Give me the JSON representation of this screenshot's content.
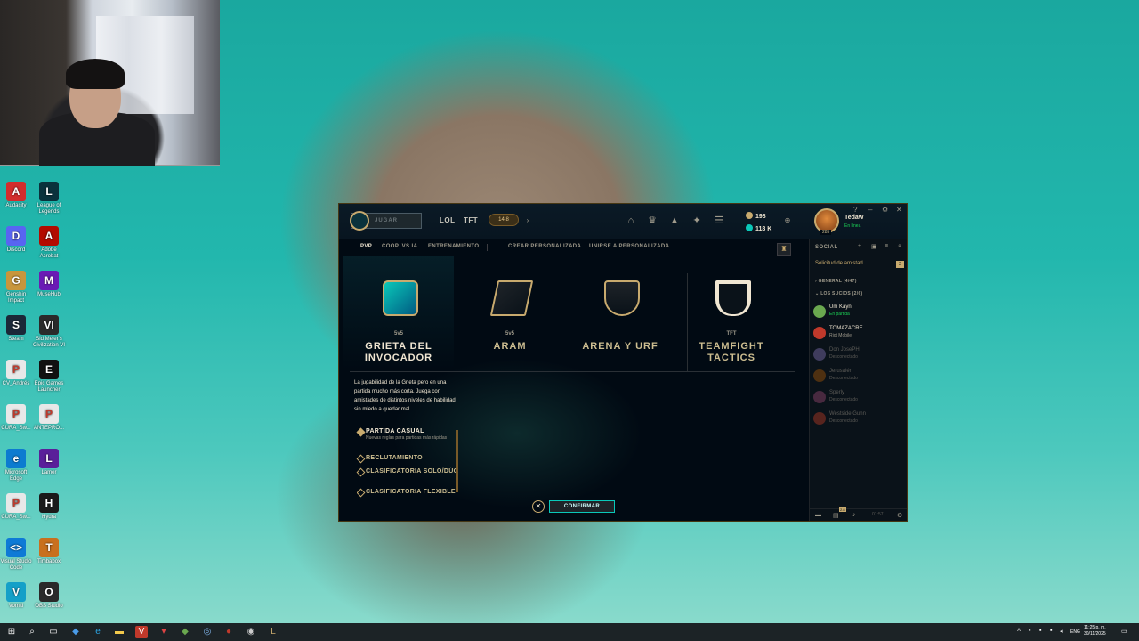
{
  "desktop_icons": [
    {
      "label": "Audacity",
      "glyph": "A",
      "color": "#d22d2d"
    },
    {
      "label": "League of Legends",
      "glyph": "L",
      "color": "#0a323c"
    },
    {
      "label": "Discord",
      "glyph": "D",
      "color": "#5865f2"
    },
    {
      "label": "Adobe Acrobat",
      "glyph": "A",
      "color": "#b30b00"
    },
    {
      "label": "Genshin Impact",
      "glyph": "G",
      "color": "#c8963c"
    },
    {
      "label": "MuseHub",
      "glyph": "M",
      "color": "#6a1bb5"
    },
    {
      "label": "Steam",
      "glyph": "S",
      "color": "#1b2838"
    },
    {
      "label": "Sid Meier's Civilization VI",
      "glyph": "VI",
      "color": "#2a2a2a"
    },
    {
      "label": "CV_Andrés",
      "glyph": "P",
      "color": "#e8e8e8"
    },
    {
      "label": "Epic Games Launcher",
      "glyph": "E",
      "color": "#111111"
    },
    {
      "label": "CURA_Sw...",
      "glyph": "P",
      "color": "#e8e8e8"
    },
    {
      "label": "ANTEPRO...",
      "glyph": "P",
      "color": "#e8e8e8"
    },
    {
      "label": "Microsoft Edge",
      "glyph": "e",
      "color": "#0c7bd0"
    },
    {
      "label": "Lamer",
      "glyph": "L",
      "color": "#5a1f9a"
    },
    {
      "label": "CURA_Sw...",
      "glyph": "P",
      "color": "#e8e8e8"
    },
    {
      "label": "Hydra",
      "glyph": "H",
      "color": "#1a1a1a"
    },
    {
      "label": "Visual Studio Code",
      "glyph": "<>",
      "color": "#0e7ad6"
    },
    {
      "label": "Timbabox",
      "glyph": "T",
      "color": "#c8701e"
    },
    {
      "label": "Vomiti",
      "glyph": "V",
      "color": "#14a0c8"
    },
    {
      "label": "OBS Studio",
      "glyph": "O",
      "color": "#2a2a2a"
    }
  ],
  "client": {
    "play_label": "JUGAR",
    "nav": {
      "lol": "LOL",
      "tft": "TFT",
      "badge": "14:8"
    },
    "currency": {
      "rp": "198",
      "be": "118 K"
    },
    "profile": {
      "name": "Tedaw",
      "status": "En línea",
      "level": "285"
    },
    "window_controls": {
      "help": "?",
      "minimize": "–",
      "settings": "⚙",
      "close": "✕"
    },
    "mode_tabs": {
      "pvp": "PVP",
      "coop": "COOP. VS IA",
      "training": "ENTRENAMIENTO",
      "create_custom": "CREAR PERSONALIZADA",
      "join_custom": "UNIRSE A PERSONALIZADA"
    },
    "queues": [
      {
        "sub": "5v5",
        "title": "GRIETA DEL INVOCADOR",
        "selected": true
      },
      {
        "sub": "5v5",
        "title": "ARAM",
        "selected": false
      },
      {
        "sub": "",
        "title": "ARENA Y URF",
        "selected": false
      },
      {
        "sub": "TFT",
        "title": "TEAMFIGHT TACTICS",
        "selected": false
      }
    ],
    "description": "La jugabilidad de la Grieta pero en una partida mucho más corta. Juega con amistades de distintos niveles de habilidad sin miedo a quedar mal.",
    "options": [
      {
        "name": "PARTIDA CASUAL",
        "sub": "Nuevas reglas para partidas más rápidas",
        "active": true
      },
      {
        "name": "RECLUTAMIENTO",
        "sub": "",
        "active": false
      },
      {
        "name": "CLASIFICATORIA SOLO/DÚO",
        "sub": "",
        "active": false
      },
      {
        "name": "CLASIFICATORIA FLEXIBLE",
        "sub": "",
        "active": false
      }
    ],
    "confirm_label": "CONFIRMAR",
    "social": {
      "title": "SOCIAL",
      "friend_requests": "Solicitud de amistad",
      "friend_requests_count": "2",
      "group_general": "GENERAL (4/47)",
      "group_sucios": "LOS SUCIOS (2/6)",
      "friends": [
        {
          "name": "Um Kayn",
          "status": "En partida",
          "state": "ingame",
          "color": "#6aa84f"
        },
        {
          "name": "TOMAZACRE",
          "status": "Riot Mobile",
          "state": "mobile",
          "color": "#c0392b"
        },
        {
          "name": "Don JosePH",
          "status": "Desconectado",
          "state": "offline",
          "color": "#8e7cc3"
        },
        {
          "name": "Jerusalén",
          "status": "Desconectado",
          "state": "offline",
          "color": "#b45f06"
        },
        {
          "name": "Sperly",
          "status": "Desconectado",
          "state": "offline",
          "color": "#a64d79"
        },
        {
          "name": "Westside Gunn",
          "status": "Desconectado",
          "state": "offline",
          "color": "#cc4125"
        }
      ],
      "footer_time": "01:57",
      "footer_badge": "2.8"
    }
  },
  "taskbar": {
    "lang": "ENG",
    "time": "11:25 p. m.",
    "date": "30/11/2025"
  }
}
